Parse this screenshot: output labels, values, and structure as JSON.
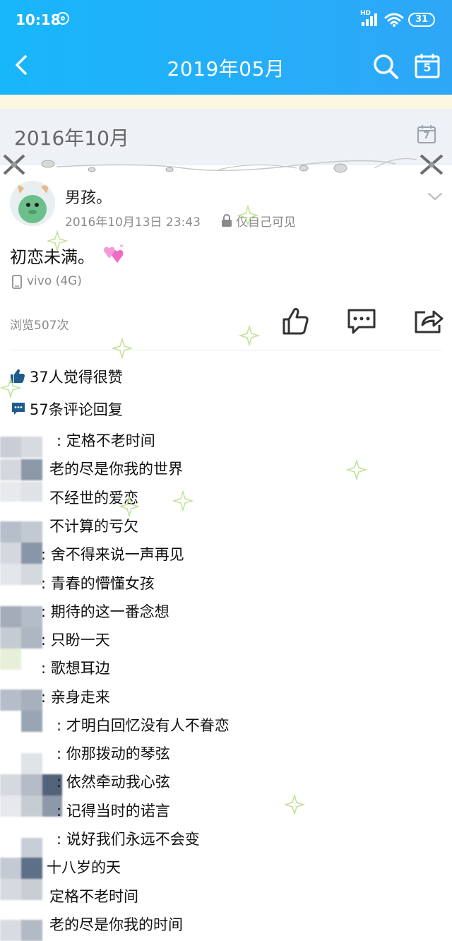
{
  "status_bar": {
    "time": "10:18",
    "network_label": "HD",
    "battery": "31"
  },
  "nav": {
    "title": "2019年05月",
    "calendar_day": "5"
  },
  "month_header": {
    "title": "2016年10月",
    "calendar_day": "7"
  },
  "post": {
    "author": "男孩。",
    "time": "2016年10月13日 23:43",
    "privacy": "仅自己可见",
    "text": "初恋未满。",
    "emoji": "sparkling-heart",
    "device": "vivo (4G)",
    "views": "浏览507次"
  },
  "engagement": {
    "likes": "37人觉得很赞",
    "comments": "57条评论回复"
  },
  "comments": [
    ": 定格不老时间",
    "老的尽是你我的世界",
    "不经世的爱恋",
    "不计算的亏欠",
    ": 舍不得来说一声再见",
    ": 青春的懵懂女孩",
    ": 期待的这一番念想",
    ": 只盼一天",
    ": 歌想耳边",
    ": 亲身走来",
    ": 才明白回忆没有人不眷恋",
    ": 你那拨动的琴弦",
    ": 依然牵动我心弦",
    ": 记得当时的诺言",
    ": 说好我们永远不会变",
    "十八岁的天",
    "定格不老时间",
    "老的尽是你我的时间"
  ],
  "colors": {
    "header_gradient_start": "#18b6fb",
    "header_gradient_end": "#2ea7f7",
    "month_header_bg": "#eef1f6",
    "accent_blue": "#1f5b8f"
  }
}
